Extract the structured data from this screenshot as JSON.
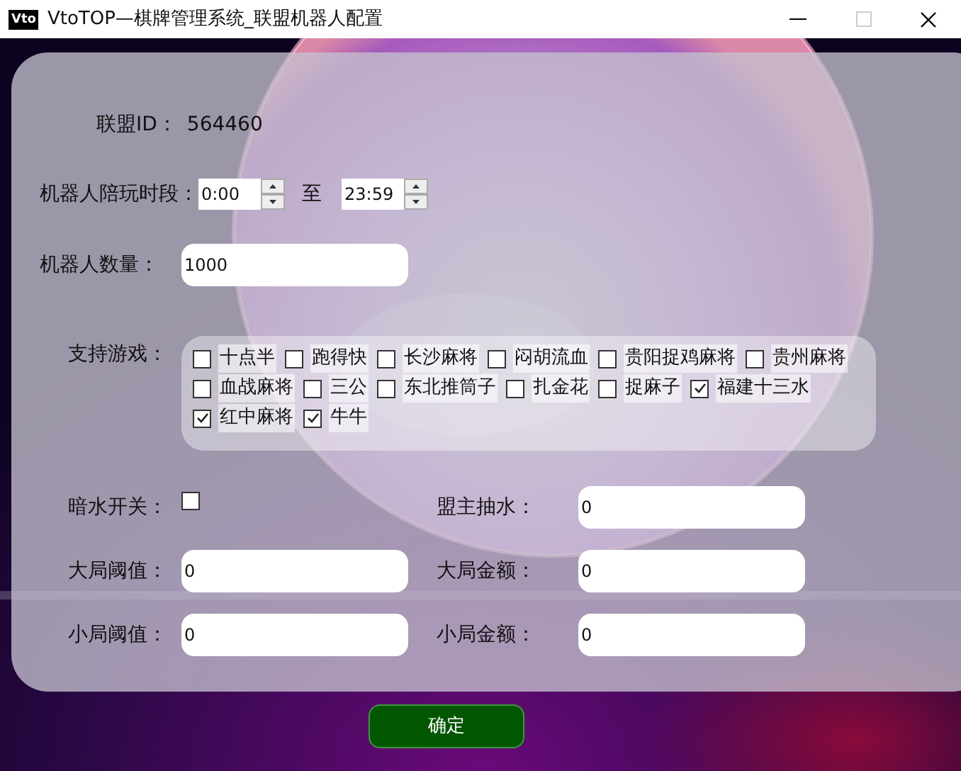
{
  "window": {
    "title": "VtoTOP—棋牌管理系统_联盟机器人配置",
    "app_icon": "Vto"
  },
  "alliance": {
    "label": "联盟ID：",
    "value": "564460"
  },
  "play_time": {
    "label": "机器人陪玩时段：",
    "start": "0:00",
    "separator": "至",
    "end": "23:59"
  },
  "robot_count": {
    "label": "机器人数量：",
    "value": "1000"
  },
  "games": {
    "label": "支持游戏：",
    "items": [
      {
        "label": "十点半",
        "checked": false
      },
      {
        "label": "跑得快",
        "checked": false
      },
      {
        "label": "长沙麻将",
        "checked": false
      },
      {
        "label": "闷胡流血",
        "checked": false
      },
      {
        "label": "贵阳捉鸡麻将",
        "checked": false
      },
      {
        "label": "贵州麻将",
        "checked": false
      },
      {
        "label": "血战麻将",
        "checked": false
      },
      {
        "label": "三公",
        "checked": false
      },
      {
        "label": "东北推筒子",
        "checked": false
      },
      {
        "label": "扎金花",
        "checked": false
      },
      {
        "label": "捉麻子",
        "checked": false
      },
      {
        "label": "福建十三水",
        "checked": true
      },
      {
        "label": "红中麻将",
        "checked": true
      },
      {
        "label": "牛牛",
        "checked": true
      }
    ]
  },
  "fields": [
    {
      "label": "暗水开关：",
      "kind": "checkbox",
      "checked": false
    },
    {
      "label": "盟主抽水：",
      "kind": "input",
      "value": "0"
    },
    {
      "label": "大局阈值：",
      "kind": "input",
      "value": "0"
    },
    {
      "label": "大局金额：",
      "kind": "input",
      "value": "0"
    },
    {
      "label": "小局阈值：",
      "kind": "input",
      "value": "0"
    },
    {
      "label": "小局金额：",
      "kind": "input",
      "value": "0"
    }
  ],
  "confirm_button": "确定"
}
